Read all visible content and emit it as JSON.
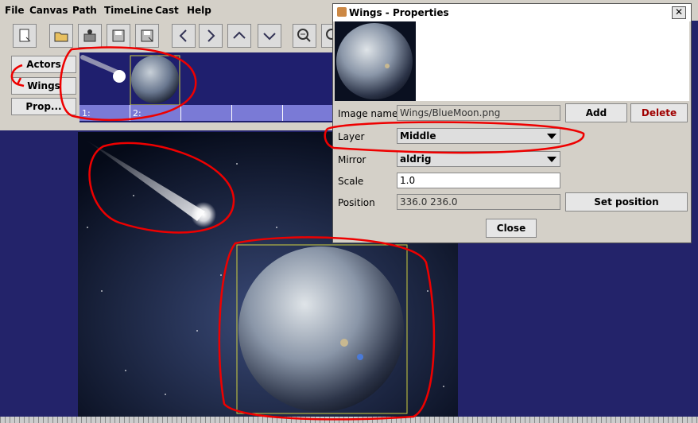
{
  "menu": [
    "File",
    "Canvas",
    "Path",
    "TimeLine",
    "Cast",
    "Help"
  ],
  "toolbar": {
    "icons": [
      "new-icon",
      "open-icon",
      "import-icon",
      "save-icon",
      "save-as-icon",
      "back-icon",
      "forward-icon",
      "up-icon",
      "down-icon",
      "zoom-out-icon",
      "zoom-in-icon"
    ]
  },
  "cast": {
    "buttons": [
      "Actors",
      "Wings",
      "Prop..."
    ]
  },
  "timeline": {
    "frames": [
      "1:",
      "2:",
      "",
      "",
      "",
      ""
    ]
  },
  "dialog": {
    "title": "Wings - Properties",
    "close_glyph": "✕",
    "image_name_label": "Image name",
    "image_name_value": "Wings/BlueMoon.png",
    "add_label": "Add",
    "delete_label": "Delete",
    "layer_label": "Layer",
    "layer_value": "Middle",
    "mirror_label": "Mirror",
    "mirror_value": "aldrig",
    "scale_label": "Scale",
    "scale_value": "1.0",
    "position_label": "Position",
    "position_value": "336.0 236.0",
    "set_position_label": "Set position",
    "close_label": "Close"
  },
  "colors": {
    "annotation": "#e00000",
    "delete_text": "#a00000",
    "background": "#23236a",
    "timeline": "#7a7ad6"
  }
}
